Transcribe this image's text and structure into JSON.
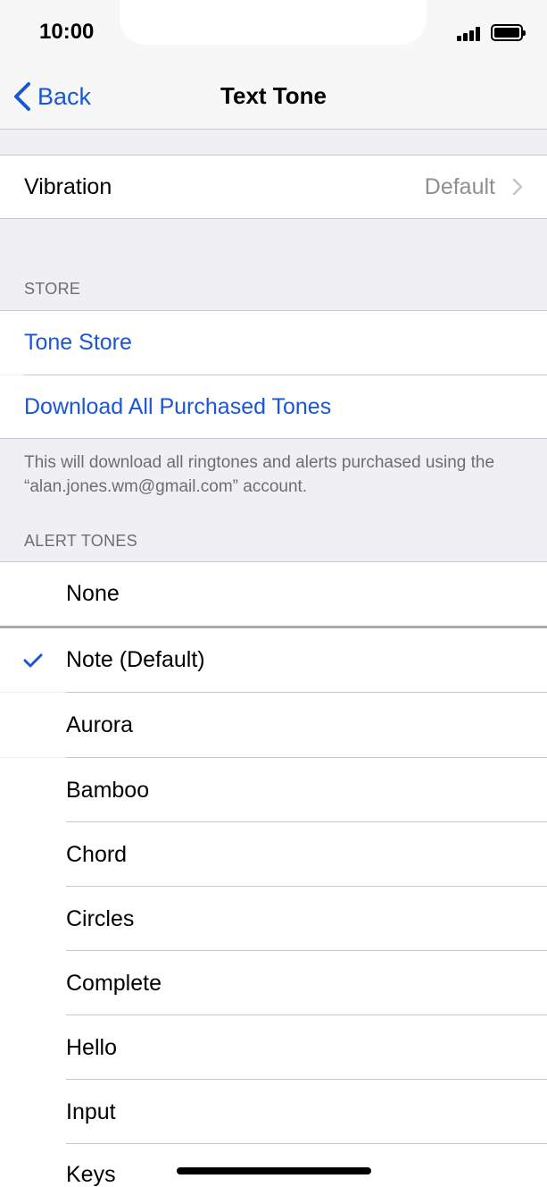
{
  "status_bar": {
    "time": "10:00"
  },
  "nav": {
    "back_label": "Back",
    "title": "Text Tone"
  },
  "vibration": {
    "label": "Vibration",
    "value": "Default"
  },
  "store": {
    "header": "STORE",
    "tone_store_label": "Tone Store",
    "download_all_label": "Download All Purchased Tones",
    "footer": "This will download all ringtones and alerts purchased using the “alan.jones.wm@gmail.com” account."
  },
  "alert_tones": {
    "header": "ALERT TONES",
    "items": [
      {
        "label": "None",
        "selected": false
      },
      {
        "label": "Note (Default)",
        "selected": true
      },
      {
        "label": "Aurora",
        "selected": false
      },
      {
        "label": "Bamboo",
        "selected": false
      },
      {
        "label": "Chord",
        "selected": false
      },
      {
        "label": "Circles",
        "selected": false
      },
      {
        "label": "Complete",
        "selected": false
      },
      {
        "label": "Hello",
        "selected": false
      },
      {
        "label": "Input",
        "selected": false
      },
      {
        "label": "Keys",
        "selected": false
      }
    ]
  },
  "colors": {
    "accent": "#1a56d6",
    "secondary_text": "#8e8e93",
    "group_background": "#efeff4"
  },
  "icons": {
    "back": "chevron-left-icon",
    "disclosure": "chevron-right-icon",
    "selected": "checkmark-icon"
  }
}
